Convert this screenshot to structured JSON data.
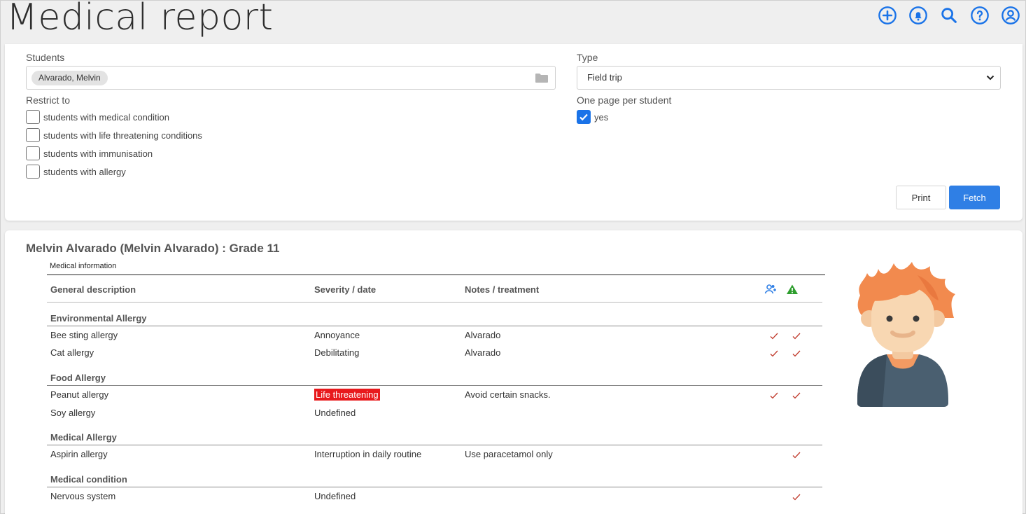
{
  "header": {
    "title": "Medical report"
  },
  "icons": [
    "add-circle-icon",
    "bell-icon",
    "search-icon",
    "help-icon",
    "account-icon"
  ],
  "filters": {
    "students_label": "Students",
    "student_chip": "Alvarado, Melvin",
    "type_label": "Type",
    "type_value": "Field trip",
    "restrict_label": "Restrict to",
    "restrict_options": [
      {
        "label": "students with medical condition",
        "checked": false
      },
      {
        "label": "students with life threatening conditions",
        "checked": false
      },
      {
        "label": "students with immunisation",
        "checked": false
      },
      {
        "label": "students with allergy",
        "checked": false
      }
    ],
    "one_page_label": "One page per student",
    "one_page_value": "yes",
    "one_page_checked": true,
    "print_label": "Print",
    "fetch_label": "Fetch"
  },
  "report": {
    "student_heading": "Melvin Alvarado (Melvin Alvarado) : Grade 11",
    "section_label": "Medical information",
    "columns": [
      "General description",
      "Severity / date",
      "Notes / treatment"
    ],
    "groups": [
      {
        "title": "Environmental Allergy",
        "rows": [
          {
            "description": "Bee sting allergy",
            "severity": "Annoyance",
            "notes": "Alvarado",
            "check1": true,
            "check2": true
          },
          {
            "description": "Cat allergy",
            "severity": "Debilitating",
            "notes": "Alvarado",
            "check1": true,
            "check2": true
          }
        ]
      },
      {
        "title": "Food Allergy",
        "rows": [
          {
            "description": "Peanut allergy",
            "severity": "Life threatening",
            "notes": "Avoid certain snacks.",
            "check1": true,
            "check2": true,
            "highlight": true
          },
          {
            "description": "Soy allergy",
            "severity": "Undefined",
            "notes": "",
            "check1": false,
            "check2": false
          }
        ]
      },
      {
        "title": "Medical Allergy",
        "rows": [
          {
            "description": "Aspirin allergy",
            "severity": "Interruption in daily routine",
            "notes": "Use paracetamol only",
            "check1": false,
            "check2": true
          }
        ]
      },
      {
        "title": "Medical condition",
        "rows": [
          {
            "description": "Nervous system",
            "severity": "Undefined",
            "notes": "",
            "check1": false,
            "check2": true
          }
        ]
      }
    ]
  },
  "colors": {
    "accent": "#1a73e8",
    "danger": "#e8191c",
    "check": "#c0392b",
    "warning": "#2e9e2e"
  }
}
